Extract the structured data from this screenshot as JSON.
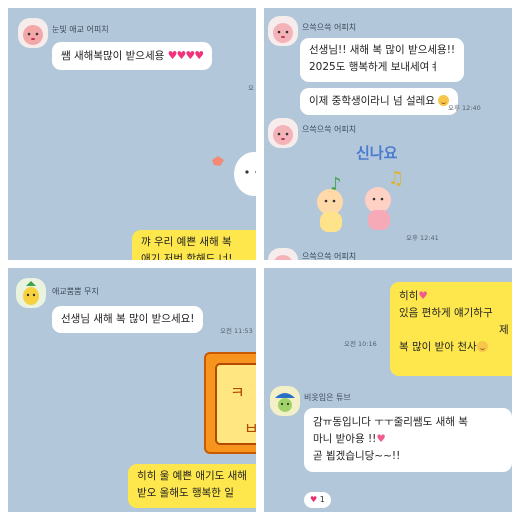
{
  "p1": {
    "name": "눈빛 애교 어피치",
    "message": "쌤 새해복많이 받으세용",
    "hearts": "♥♥♥♥",
    "time": "오",
    "reply_line1": "꺄 우리 예쁜      새해 복",
    "reply_line2": "애기 저번 학해드 너!"
  },
  "p2": {
    "name": "으쓱으쓱 어피치",
    "msg1_line1": "선생님!! 새해 복 많이 받으세용!!",
    "msg1_line2": "2025도 행복하게 보내세여ㅕ",
    "msg2": "이제 중학생이라니 넘 설레요",
    "time1": "오후 12:40",
    "name2": "으쓱으쓱 어피치",
    "sticker_text": "신나요",
    "time2": "오후 12:41",
    "name3": "으쓱으쓱 어피치"
  },
  "p3": {
    "name": "애교뿜뿜 무지",
    "message": "선생님 새해 복 많이 받으세요!",
    "time": "오전 11:53",
    "reply_line1": "히히 울 예쁜 애기도 새해",
    "reply_line2": "받오   올해도 행복한 일"
  },
  "p4": {
    "out_line1": "히히",
    "out_line2": "있음 편하게 얘기하구",
    "out_line3": "제",
    "out_line4": "복 많이 받아 천사",
    "time": "오전 10:16",
    "name": "비옷입은 튜브",
    "in_line1": "감ㅠ동입니다 ㅜㅜ줄리쌤도 새해 복",
    "in_line2": "마니 받아용 !!",
    "in_line3": "곧 뵙겠습니당~~!!",
    "reaction_count": "1"
  },
  "colors": {
    "chat_bg": "#b2c7da",
    "my_bubble": "#fde74c",
    "their_bubble": "#ffffff",
    "heart": "#f0337a"
  }
}
